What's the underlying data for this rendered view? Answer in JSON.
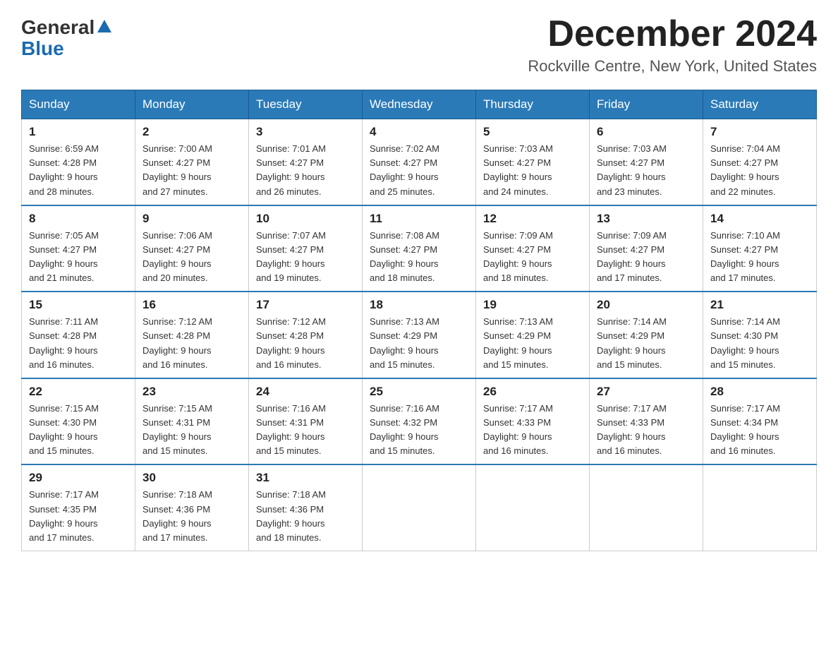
{
  "header": {
    "logo_general": "General",
    "logo_blue": "Blue",
    "month_title": "December 2024",
    "location": "Rockville Centre, New York, United States"
  },
  "weekdays": [
    "Sunday",
    "Monday",
    "Tuesday",
    "Wednesday",
    "Thursday",
    "Friday",
    "Saturday"
  ],
  "weeks": [
    [
      {
        "day": "1",
        "sunrise": "6:59 AM",
        "sunset": "4:28 PM",
        "daylight": "9 hours and 28 minutes."
      },
      {
        "day": "2",
        "sunrise": "7:00 AM",
        "sunset": "4:27 PM",
        "daylight": "9 hours and 27 minutes."
      },
      {
        "day": "3",
        "sunrise": "7:01 AM",
        "sunset": "4:27 PM",
        "daylight": "9 hours and 26 minutes."
      },
      {
        "day": "4",
        "sunrise": "7:02 AM",
        "sunset": "4:27 PM",
        "daylight": "9 hours and 25 minutes."
      },
      {
        "day": "5",
        "sunrise": "7:03 AM",
        "sunset": "4:27 PM",
        "daylight": "9 hours and 24 minutes."
      },
      {
        "day": "6",
        "sunrise": "7:03 AM",
        "sunset": "4:27 PM",
        "daylight": "9 hours and 23 minutes."
      },
      {
        "day": "7",
        "sunrise": "7:04 AM",
        "sunset": "4:27 PM",
        "daylight": "9 hours and 22 minutes."
      }
    ],
    [
      {
        "day": "8",
        "sunrise": "7:05 AM",
        "sunset": "4:27 PM",
        "daylight": "9 hours and 21 minutes."
      },
      {
        "day": "9",
        "sunrise": "7:06 AM",
        "sunset": "4:27 PM",
        "daylight": "9 hours and 20 minutes."
      },
      {
        "day": "10",
        "sunrise": "7:07 AM",
        "sunset": "4:27 PM",
        "daylight": "9 hours and 19 minutes."
      },
      {
        "day": "11",
        "sunrise": "7:08 AM",
        "sunset": "4:27 PM",
        "daylight": "9 hours and 18 minutes."
      },
      {
        "day": "12",
        "sunrise": "7:09 AM",
        "sunset": "4:27 PM",
        "daylight": "9 hours and 18 minutes."
      },
      {
        "day": "13",
        "sunrise": "7:09 AM",
        "sunset": "4:27 PM",
        "daylight": "9 hours and 17 minutes."
      },
      {
        "day": "14",
        "sunrise": "7:10 AM",
        "sunset": "4:27 PM",
        "daylight": "9 hours and 17 minutes."
      }
    ],
    [
      {
        "day": "15",
        "sunrise": "7:11 AM",
        "sunset": "4:28 PM",
        "daylight": "9 hours and 16 minutes."
      },
      {
        "day": "16",
        "sunrise": "7:12 AM",
        "sunset": "4:28 PM",
        "daylight": "9 hours and 16 minutes."
      },
      {
        "day": "17",
        "sunrise": "7:12 AM",
        "sunset": "4:28 PM",
        "daylight": "9 hours and 16 minutes."
      },
      {
        "day": "18",
        "sunrise": "7:13 AM",
        "sunset": "4:29 PM",
        "daylight": "9 hours and 15 minutes."
      },
      {
        "day": "19",
        "sunrise": "7:13 AM",
        "sunset": "4:29 PM",
        "daylight": "9 hours and 15 minutes."
      },
      {
        "day": "20",
        "sunrise": "7:14 AM",
        "sunset": "4:29 PM",
        "daylight": "9 hours and 15 minutes."
      },
      {
        "day": "21",
        "sunrise": "7:14 AM",
        "sunset": "4:30 PM",
        "daylight": "9 hours and 15 minutes."
      }
    ],
    [
      {
        "day": "22",
        "sunrise": "7:15 AM",
        "sunset": "4:30 PM",
        "daylight": "9 hours and 15 minutes."
      },
      {
        "day": "23",
        "sunrise": "7:15 AM",
        "sunset": "4:31 PM",
        "daylight": "9 hours and 15 minutes."
      },
      {
        "day": "24",
        "sunrise": "7:16 AM",
        "sunset": "4:31 PM",
        "daylight": "9 hours and 15 minutes."
      },
      {
        "day": "25",
        "sunrise": "7:16 AM",
        "sunset": "4:32 PM",
        "daylight": "9 hours and 15 minutes."
      },
      {
        "day": "26",
        "sunrise": "7:17 AM",
        "sunset": "4:33 PM",
        "daylight": "9 hours and 16 minutes."
      },
      {
        "day": "27",
        "sunrise": "7:17 AM",
        "sunset": "4:33 PM",
        "daylight": "9 hours and 16 minutes."
      },
      {
        "day": "28",
        "sunrise": "7:17 AM",
        "sunset": "4:34 PM",
        "daylight": "9 hours and 16 minutes."
      }
    ],
    [
      {
        "day": "29",
        "sunrise": "7:17 AM",
        "sunset": "4:35 PM",
        "daylight": "9 hours and 17 minutes."
      },
      {
        "day": "30",
        "sunrise": "7:18 AM",
        "sunset": "4:36 PM",
        "daylight": "9 hours and 17 minutes."
      },
      {
        "day": "31",
        "sunrise": "7:18 AM",
        "sunset": "4:36 PM",
        "daylight": "9 hours and 18 minutes."
      },
      null,
      null,
      null,
      null
    ]
  ],
  "cell_labels": {
    "sunrise_prefix": "Sunrise: ",
    "sunset_prefix": "Sunset: ",
    "daylight_prefix": "Daylight: "
  }
}
